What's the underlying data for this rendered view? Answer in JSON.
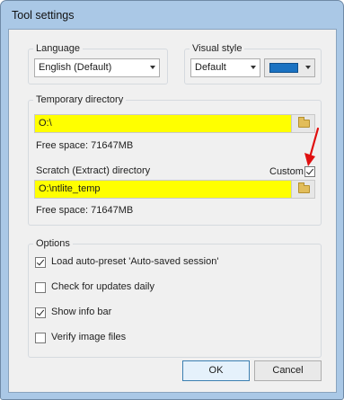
{
  "window": {
    "title": "Tool settings"
  },
  "language": {
    "group_label": "Language",
    "selected": "English (Default)"
  },
  "visual_style": {
    "group_label": "Visual style",
    "selected": "Default",
    "color": "#1a72c2"
  },
  "temp_dir": {
    "group_label": "Temporary directory",
    "path": "O:\\",
    "free_space": "Free space: 71647MB",
    "field_color": "#ffff00"
  },
  "scratch_dir": {
    "label": "Scratch (Extract) directory",
    "custom_label": "Custom",
    "custom_checked": true,
    "path": "O:\\ntlite_temp",
    "free_space": "Free space: 71647MB"
  },
  "options": {
    "group_label": "Options",
    "items": [
      {
        "label": "Load auto-preset 'Auto-saved session'",
        "checked": true
      },
      {
        "label": "Check for updates daily",
        "checked": false
      },
      {
        "label": "Show info bar",
        "checked": true
      },
      {
        "label": "Verify image files",
        "checked": false
      }
    ]
  },
  "buttons": {
    "ok": "OK",
    "cancel": "Cancel"
  },
  "annotation": {
    "arrow_color": "#e01010"
  }
}
